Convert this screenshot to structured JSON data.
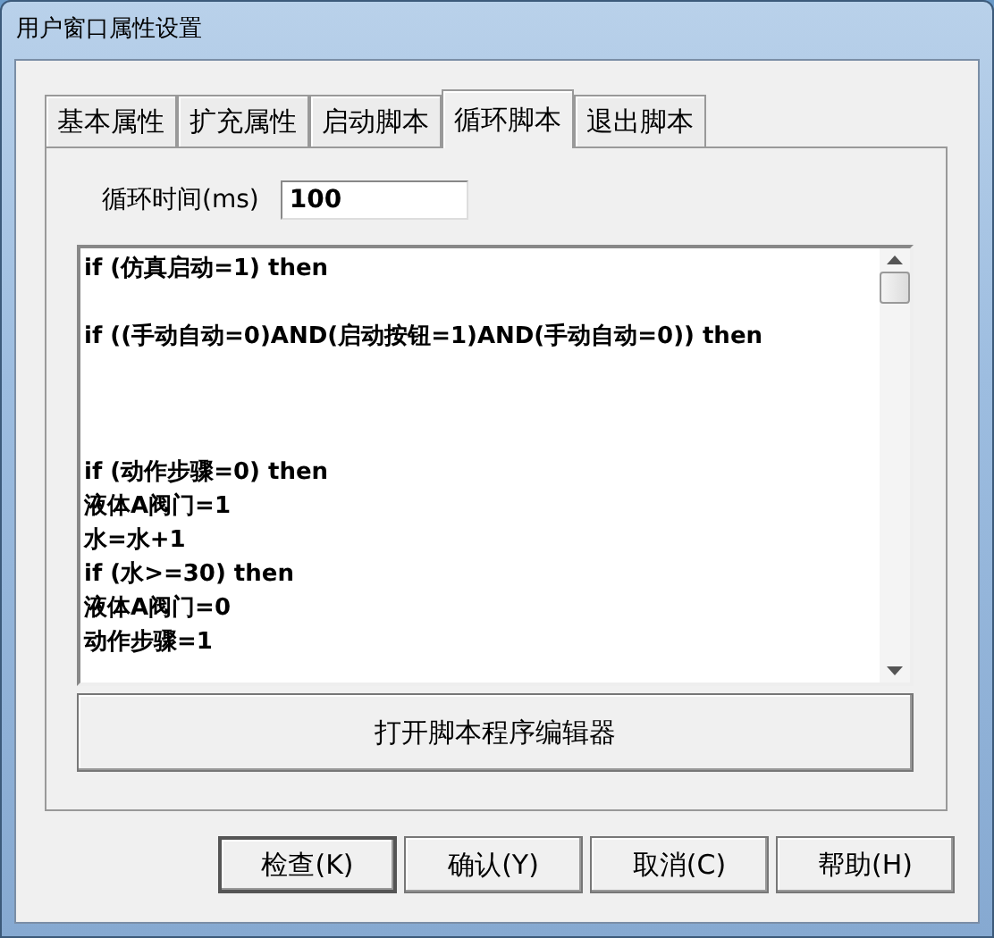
{
  "window": {
    "title": "用户窗口属性设置"
  },
  "tabs": [
    {
      "label": "基本属性",
      "selected": false
    },
    {
      "label": "扩充属性",
      "selected": false
    },
    {
      "label": "启动脚本",
      "selected": false
    },
    {
      "label": "循环脚本",
      "selected": true
    },
    {
      "label": "退出脚本",
      "selected": false
    }
  ],
  "cycle_time": {
    "label": "循环时间(ms)",
    "value": "100"
  },
  "script": {
    "value": "if (仿真启动=1) then\n\nif ((手动自动=0)AND(启动按钮=1)AND(手动自动=0)) then\n\n\n\nif (动作步骤=0) then\n液体A阀门=1\n水=水+1\nif (水>=30) then\n液体A阀门=0\n动作步骤=1"
  },
  "editor_button": "打开脚本程序编辑器",
  "buttons": [
    {
      "label": "检查(K)",
      "default": true
    },
    {
      "label": "确认(Y)",
      "default": false
    },
    {
      "label": "取消(C)",
      "default": false
    },
    {
      "label": "帮助(H)",
      "default": false
    }
  ]
}
